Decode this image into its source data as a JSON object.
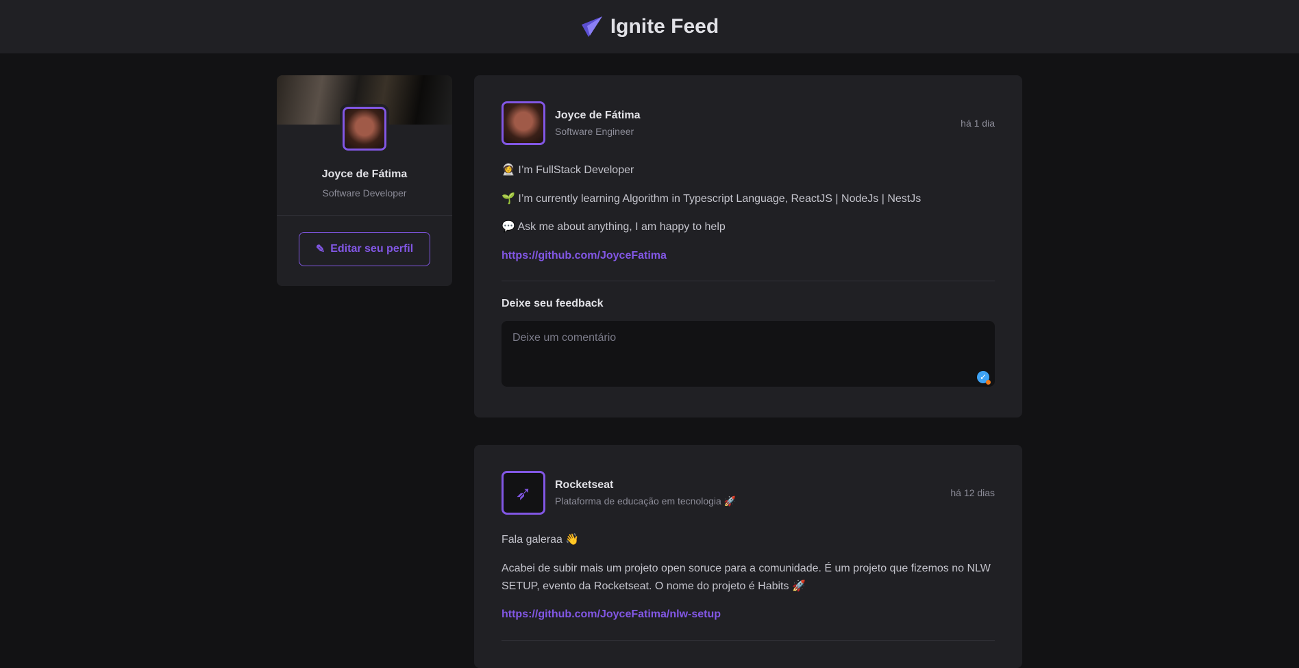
{
  "header": {
    "title": "Ignite Feed",
    "logo": "ignite-logo-icon"
  },
  "sidebar": {
    "name": "Joyce de Fátima",
    "role": "Software Developer",
    "edit_label": "Editar seu perfil"
  },
  "posts": [
    {
      "author": "Joyce de Fátima",
      "role": "Software Engineer",
      "time": "há 1 dia",
      "lines": [
        "👩‍🚀 I’m FullStack Developer",
        "🌱 I’m currently learning Algorithm in Typescript Language, ReactJS | NodeJs | NestJs",
        "💬 Ask me about anything, I am happy to help"
      ],
      "link": "https://github.com/JoyceFatima",
      "feedback_title": "Deixe seu feedback",
      "comment_placeholder": "Deixe um comentário"
    },
    {
      "author": "Rocketseat",
      "role": "Plataforma de educação em tecnologia 🚀",
      "time": "há 12 dias",
      "lines": [
        "Fala galeraa 👋",
        "Acabei de subir mais um projeto open soruce para a comunidade. É um projeto que fizemos no NLW SETUP, evento da Rocketseat. O nome do projeto é Habits 🚀"
      ],
      "link": "https://github.com/JoyceFatima/nlw-setup"
    }
  ],
  "colors": {
    "accent": "#8257e5",
    "bg": "#121214",
    "card": "#202024"
  }
}
